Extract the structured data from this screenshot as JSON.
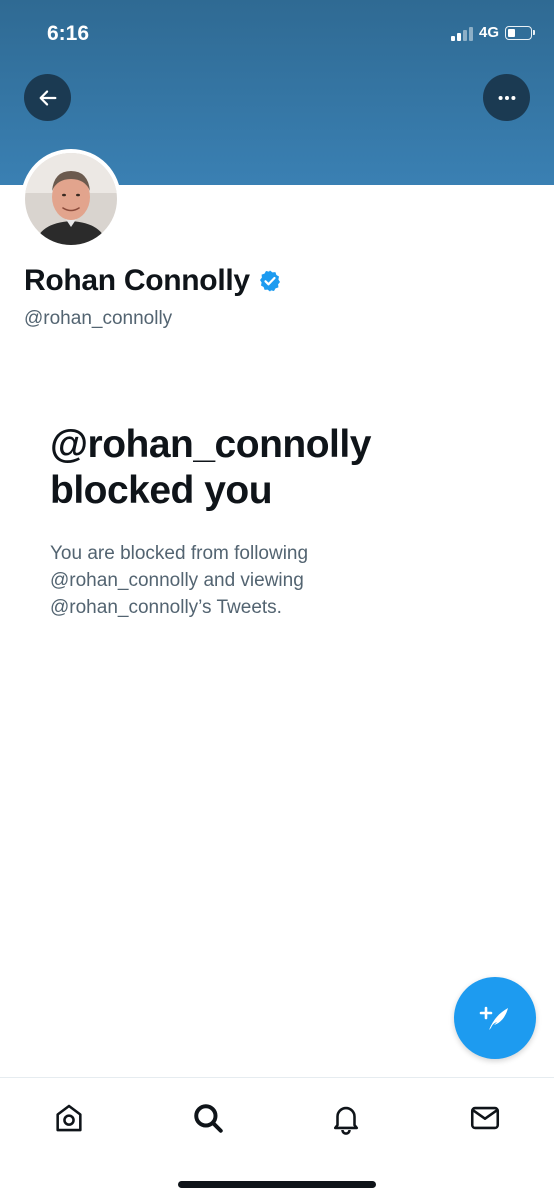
{
  "status_bar": {
    "time": "6:16",
    "network": "4G",
    "battery_level": 0.25
  },
  "header": {
    "back_icon": "arrow-left-icon",
    "more_icon": "more-horizontal-icon",
    "banner_color": "#3a7fb0"
  },
  "profile": {
    "display_name": "Rohan Connolly",
    "handle": "@rohan_connolly",
    "verified": true,
    "verified_color": "#1d9bf0"
  },
  "blocked": {
    "title_line1": "@rohan_connolly",
    "title_line2": "blocked you",
    "description_line1": "You are blocked from following",
    "description_line2": "@rohan_connolly and viewing",
    "description_line3": "@rohan_connolly’s Tweets."
  },
  "fab": {
    "icon": "compose-tweet-icon",
    "color": "#1d9bf0"
  },
  "tabbar": {
    "items": [
      {
        "icon": "home-icon"
      },
      {
        "icon": "search-icon"
      },
      {
        "icon": "bell-icon"
      },
      {
        "icon": "mail-icon"
      }
    ]
  }
}
